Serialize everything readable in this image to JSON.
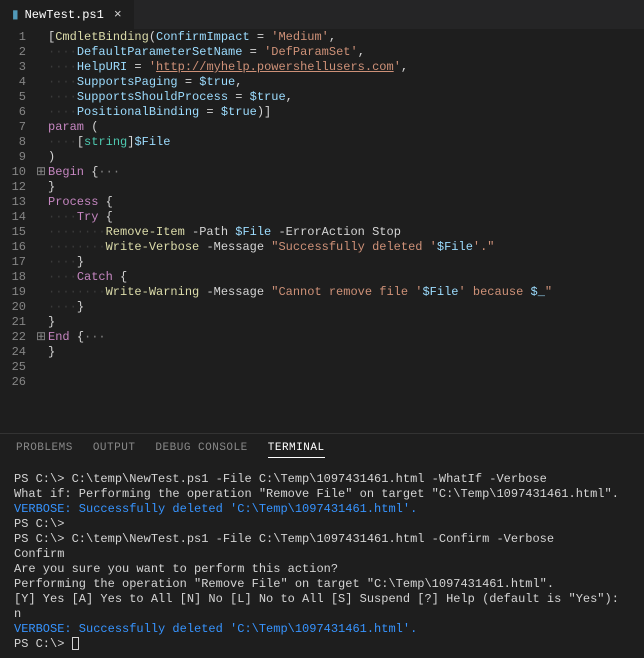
{
  "tab": {
    "filename": "NewTest.ps1"
  },
  "panel": {
    "tabs": [
      "PROBLEMS",
      "OUTPUT",
      "DEBUG CONSOLE",
      "TERMINAL"
    ],
    "active": "TERMINAL"
  },
  "code": {
    "lines": [
      {
        "n": 1,
        "g": "",
        "html": "<span class='pwsh-op'>[</span><span class='pwsh-attr'>CmdletBinding</span><span class='pwsh-op'>(</span><span class='pwsh-param'>ConfirmImpact</span><span class='pwsh-op'> = </span><span class='pwsh-string'>'Medium'</span><span class='pwsh-op'>,</span>"
      },
      {
        "n": 2,
        "g": "",
        "html": "<span class='ws'>····</span><span class='pwsh-param'>DefaultParameterSetName</span><span class='pwsh-op'> = </span><span class='pwsh-string'>'DefParamSet'</span><span class='pwsh-op'>,</span>"
      },
      {
        "n": 3,
        "g": "",
        "html": "<span class='ws'>····</span><span class='pwsh-param'>HelpURI</span><span class='pwsh-op'> = </span><span class='pwsh-string'>'<span class='underline'>http://myhelp.powershellusers.com</span>'</span><span class='pwsh-op'>,</span>"
      },
      {
        "n": 4,
        "g": "",
        "html": "<span class='ws'>····</span><span class='pwsh-param'>SupportsPaging</span><span class='pwsh-op'> = </span><span class='pwsh-var'>$true</span><span class='pwsh-op'>,</span>"
      },
      {
        "n": 5,
        "g": "",
        "html": "<span class='ws'>····</span><span class='pwsh-param'>SupportsShouldProcess</span><span class='pwsh-op'> = </span><span class='pwsh-var'>$true</span><span class='pwsh-op'>,</span>"
      },
      {
        "n": 6,
        "g": "",
        "html": "<span class='ws'>····</span><span class='pwsh-param'>PositionalBinding</span><span class='pwsh-op'> = </span><span class='pwsh-var'>$true</span><span class='pwsh-op'>)]</span>"
      },
      {
        "n": 7,
        "g": "",
        "html": "<span class='pwsh-keyword'>param</span> <span class='pwsh-op'>(</span>"
      },
      {
        "n": 8,
        "g": "",
        "html": "<span class='ws'>····</span><span class='pwsh-op'>[</span><span class='pwsh-type'>string</span><span class='pwsh-op'>]</span><span class='pwsh-var'>$File</span>"
      },
      {
        "n": 9,
        "g": "",
        "html": "<span class='pwsh-op'>)</span>"
      },
      {
        "n": 10,
        "g": "⊞",
        "html": "<span class='pwsh-keyword'>Begin</span> <span class='pwsh-op'>{</span><span class='fold-dots'>···</span>"
      },
      {
        "n": 12,
        "g": "",
        "html": "<span class='pwsh-op'>}</span>"
      },
      {
        "n": 13,
        "g": "",
        "html": "<span class='pwsh-keyword'>Process</span> <span class='pwsh-op'>{</span>"
      },
      {
        "n": 14,
        "g": "",
        "html": "<span class='ws'>····</span><span class='pwsh-keyword'>Try</span> <span class='pwsh-op'>{</span>"
      },
      {
        "n": 15,
        "g": "",
        "html": "<span class='ws'>········</span><span class='pwsh-cmd'>Remove-Item</span> <span class='pwsh-plain'>-Path</span> <span class='pwsh-var'>$File</span> <span class='pwsh-plain'>-ErrorAction Stop</span>"
      },
      {
        "n": 16,
        "g": "",
        "html": "<span class='ws'>········</span><span class='pwsh-cmd'>Write-Verbose</span> <span class='pwsh-plain'>-Message</span> <span class='pwsh-string'>\"Successfully deleted '</span><span class='pwsh-var'>$File</span><span class='pwsh-string'>'.\"</span>"
      },
      {
        "n": 17,
        "g": "",
        "html": "<span class='ws'>····</span><span class='pwsh-op'>}</span>"
      },
      {
        "n": 18,
        "g": "",
        "html": "<span class='ws'>····</span><span class='pwsh-keyword'>Catch</span> <span class='pwsh-op'>{</span>"
      },
      {
        "n": 19,
        "g": "",
        "html": "<span class='ws'>········</span><span class='pwsh-cmd'>Write-Warning</span> <span class='pwsh-plain'>-Message</span> <span class='pwsh-string'>\"Cannot remove file '</span><span class='pwsh-var'>$File</span><span class='pwsh-string'>' because </span><span class='pwsh-var'>$_</span><span class='pwsh-string'>\"</span>"
      },
      {
        "n": 20,
        "g": "",
        "html": "<span class='ws'>····</span><span class='pwsh-op'>}</span>"
      },
      {
        "n": 21,
        "g": "",
        "html": "<span class='pwsh-op'>}</span>"
      },
      {
        "n": 22,
        "g": "⊞",
        "html": "<span class='pwsh-keyword'>End</span> <span class='pwsh-op'>{</span><span class='fold-dots'>···</span>"
      },
      {
        "n": 24,
        "g": "",
        "html": "<span class='pwsh-op'>}</span>"
      },
      {
        "n": 25,
        "g": "",
        "html": ""
      },
      {
        "n": 26,
        "g": "",
        "html": ""
      }
    ]
  },
  "terminal": {
    "lines": [
      {
        "cls": "",
        "text": "PS C:\\> C:\\temp\\NewTest.ps1 -File C:\\Temp\\1097431461.html -WhatIf -Verbose"
      },
      {
        "cls": "",
        "text": "What if: Performing the operation \"Remove File\" on target \"C:\\Temp\\1097431461.html\"."
      },
      {
        "cls": "verbose",
        "text": "VERBOSE: Successfully deleted 'C:\\Temp\\1097431461.html'."
      },
      {
        "cls": "",
        "text": "PS C:\\>"
      },
      {
        "cls": "",
        "text": "PS C:\\> C:\\temp\\NewTest.ps1 -File C:\\Temp\\1097431461.html -Confirm -Verbose"
      },
      {
        "cls": "",
        "text": "Confirm"
      },
      {
        "cls": "",
        "text": "Are you sure you want to perform this action?"
      },
      {
        "cls": "",
        "text": "Performing the operation \"Remove File\" on target \"C:\\Temp\\1097431461.html\"."
      },
      {
        "cls": "",
        "text": "[Y] Yes [A] Yes to All [N] No [L] No to All [S] Suspend [?] Help (default is \"Yes\"): n"
      },
      {
        "cls": "verbose",
        "text": "VERBOSE: Successfully deleted 'C:\\Temp\\1097431461.html'."
      },
      {
        "cls": "",
        "text": "PS C:\\> ",
        "cursor": true
      }
    ]
  }
}
